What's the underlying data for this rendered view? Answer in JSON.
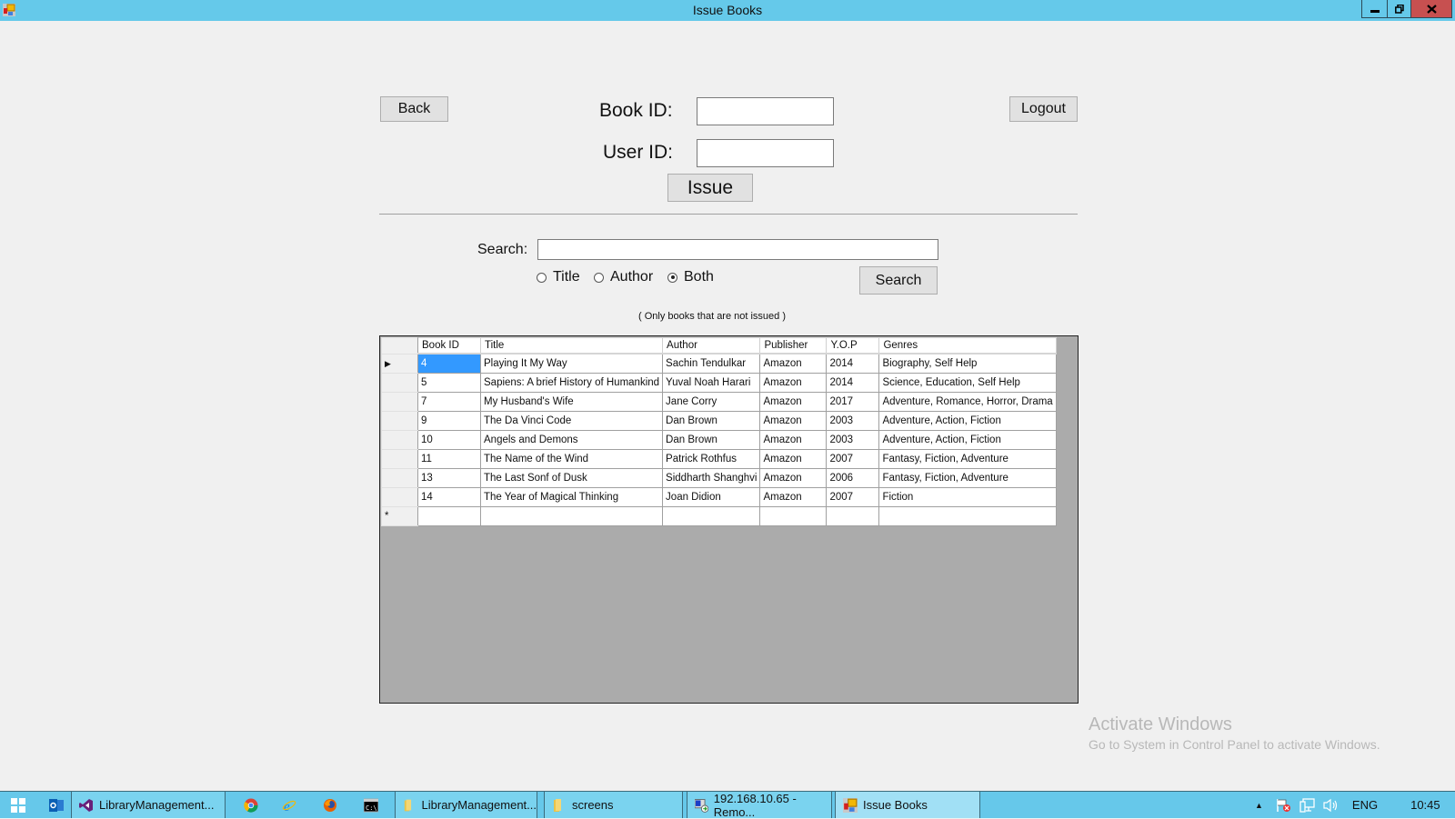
{
  "window": {
    "title": "Issue Books",
    "controls": {
      "minimize": "minimize",
      "restore": "restore",
      "close": "close"
    }
  },
  "form": {
    "back_label": "Back",
    "logout_label": "Logout",
    "book_id_label": "Book ID:",
    "book_id_value": "",
    "user_id_label": "User ID:",
    "user_id_value": "",
    "issue_label": "Issue"
  },
  "search": {
    "label": "Search:",
    "value": "",
    "options": [
      {
        "label": "Title",
        "checked": false
      },
      {
        "label": "Author",
        "checked": false
      },
      {
        "label": "Both",
        "checked": true
      }
    ],
    "button_label": "Search",
    "note": "( Only books that are not issued )"
  },
  "grid": {
    "columns": [
      "Book ID",
      "Title",
      "Author",
      "Publisher",
      "Y.O.P",
      "Genres"
    ],
    "rows": [
      [
        "4",
        "Playing It My Way",
        "Sachin Tendulkar",
        "Amazon",
        "2014",
        "Biography, Self Help"
      ],
      [
        "5",
        "Sapiens: A brief History of Humankind",
        "Yuval Noah Harari",
        "Amazon",
        "2014",
        "Science, Education, Self Help"
      ],
      [
        "7",
        "My Husband's Wife",
        "Jane Corry",
        "Amazon",
        "2017",
        "Adventure, Romance, Horror, Drama"
      ],
      [
        "9",
        "The Da Vinci Code",
        "Dan Brown",
        "Amazon",
        "2003",
        "Adventure, Action, Fiction"
      ],
      [
        "10",
        "Angels and Demons",
        "Dan Brown",
        "Amazon",
        "2003",
        "Adventure, Action, Fiction"
      ],
      [
        "11",
        "The Name of the Wind",
        "Patrick Rothfus",
        "Amazon",
        "2007",
        "Fantasy, Fiction, Adventure"
      ],
      [
        "13",
        "The Last Sonf of Dusk",
        "Siddharth Shanghvi",
        "Amazon",
        "2006",
        "Fantasy, Fiction, Adventure"
      ],
      [
        "14",
        "The Year of Magical Thinking",
        "Joan Didion",
        "Amazon",
        "2007",
        "Fiction"
      ]
    ],
    "current_row_marker": "▶",
    "new_row_marker": "*"
  },
  "watermark": {
    "line1": "Activate Windows",
    "line2": "Go to System in Control Panel to activate Windows."
  },
  "taskbar": {
    "items": [
      {
        "icon": "start-icon",
        "label": ""
      },
      {
        "icon": "outlook-icon",
        "label": ""
      },
      {
        "icon": "visual-studio-icon",
        "label": "LibraryManagement..."
      },
      {
        "icon": "chrome-icon",
        "label": ""
      },
      {
        "icon": "internet-explorer-icon",
        "label": ""
      },
      {
        "icon": "firefox-icon",
        "label": ""
      },
      {
        "icon": "cmd-icon",
        "label": ""
      },
      {
        "icon": "folder-icon",
        "label": "LibraryManagement..."
      },
      {
        "icon": "folder-icon",
        "label": "screens"
      },
      {
        "icon": "remote-desktop-icon",
        "label": "192.168.10.65 - Remo..."
      },
      {
        "icon": "app-icon",
        "label": "Issue Books"
      }
    ],
    "tray": {
      "language": "ENG",
      "time": "10:45"
    }
  }
}
